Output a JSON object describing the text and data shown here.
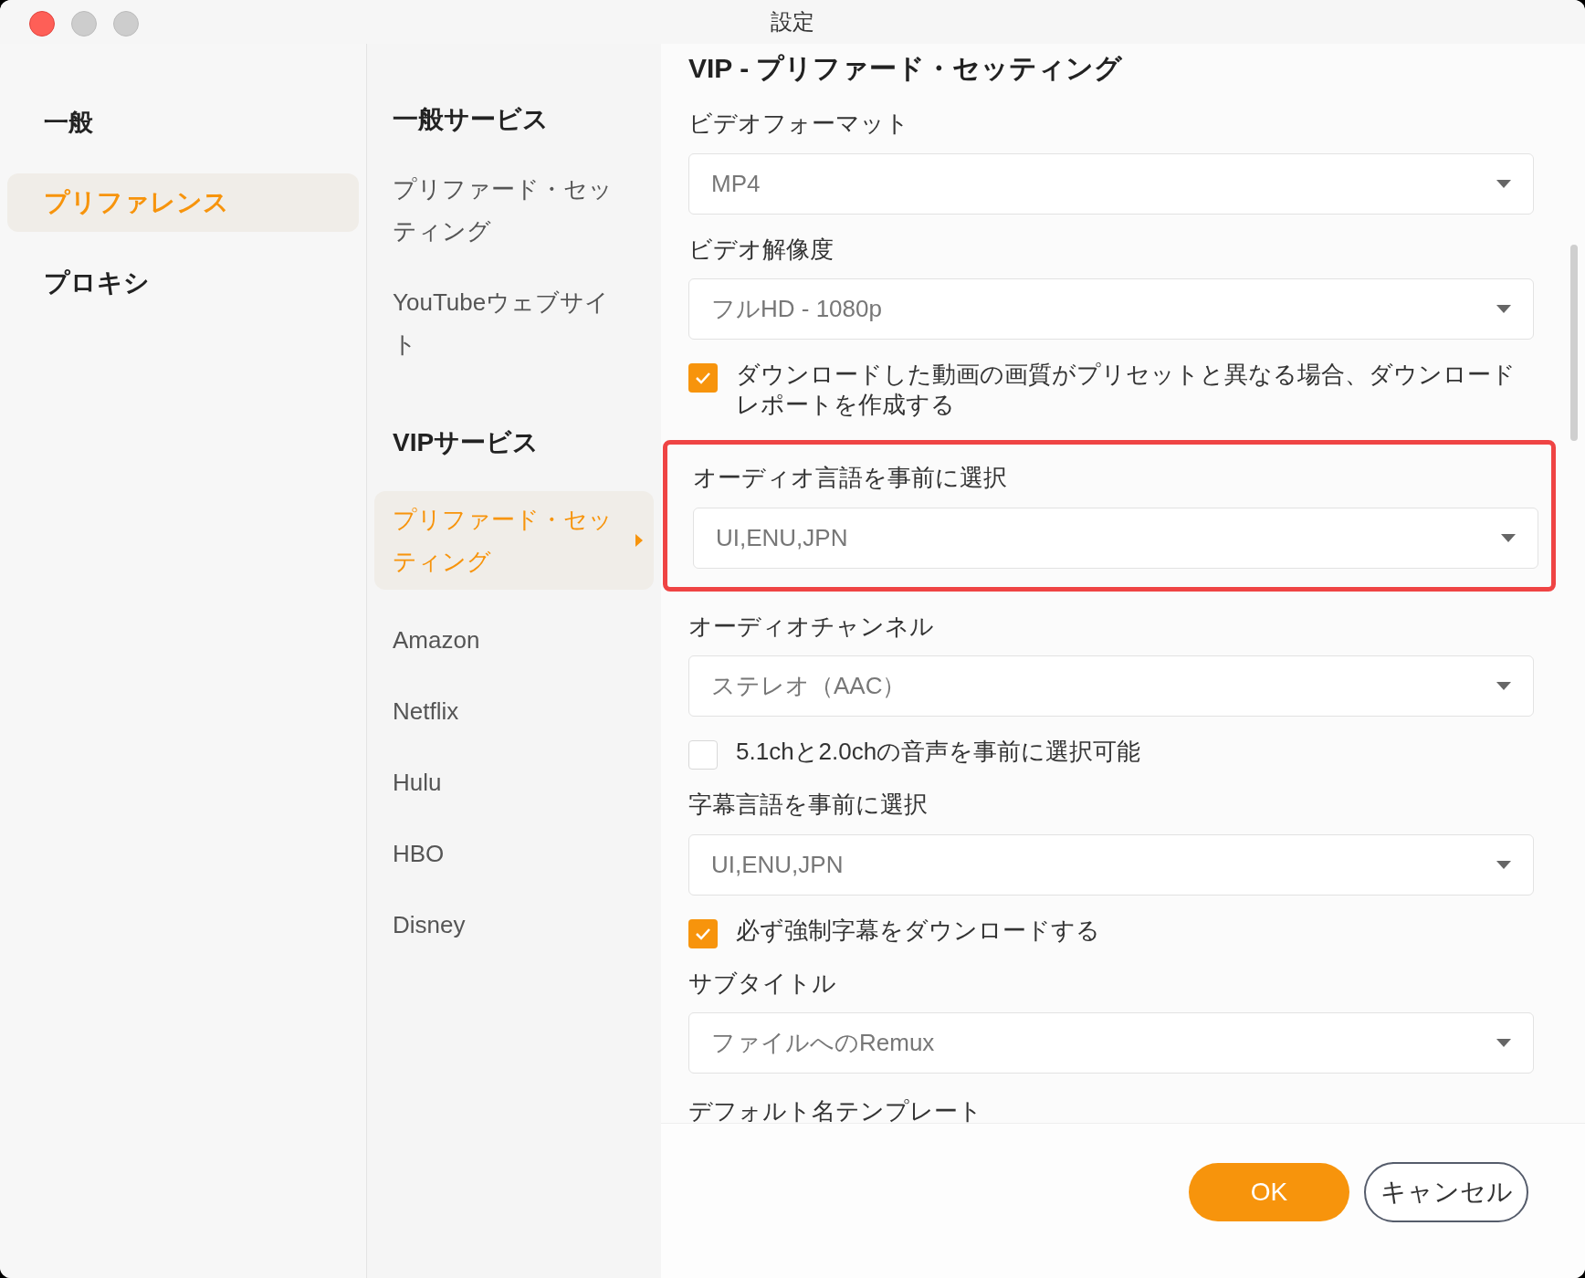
{
  "window": {
    "title": "設定"
  },
  "sidebar": {
    "items": [
      {
        "label": "一般",
        "kind": "heading",
        "selected": false
      },
      {
        "label": "プリファレンス",
        "kind": "item",
        "selected": true
      },
      {
        "label": "プロキシ",
        "kind": "item",
        "selected": false
      }
    ]
  },
  "services": [
    {
      "heading": "一般サービス",
      "items": [
        {
          "label": "プリファード・セッティング",
          "selected": false
        },
        {
          "label": "YouTubeウェブサイト",
          "selected": false
        }
      ]
    },
    {
      "heading": "VIPサービス",
      "items": [
        {
          "label": "プリファード・セッティング",
          "selected": true
        },
        {
          "label": "Amazon",
          "selected": false
        },
        {
          "label": "Netflix",
          "selected": false
        },
        {
          "label": "Hulu",
          "selected": false
        },
        {
          "label": "HBO",
          "selected": false
        },
        {
          "label": "Disney",
          "selected": false
        }
      ]
    }
  ],
  "content": {
    "title": "VIP - プリファード・セッティング",
    "settings": [
      {
        "kind": "dropdown",
        "label": "ビデオフォーマット",
        "value": "MP4",
        "highlighted": false
      },
      {
        "kind": "dropdown",
        "label": "ビデオ解像度",
        "value": "フルHD - 1080p",
        "highlighted": false
      },
      {
        "kind": "checkbox",
        "label": "ダウンロードした動画の画質がプリセットと異なる場合、ダウンロードレポートを作成する",
        "checked": true
      },
      {
        "kind": "dropdown",
        "label": "オーディオ言語を事前に選択",
        "value": "UI,ENU,JPN",
        "highlighted": true
      },
      {
        "kind": "dropdown",
        "label": "オーディオチャンネル",
        "value": "ステレオ（AAC）",
        "highlighted": false
      },
      {
        "kind": "checkbox",
        "label": "5.1chと2.0chの音声を事前に選択可能",
        "checked": false
      },
      {
        "kind": "dropdown",
        "label": "字幕言語を事前に選択",
        "value": "UI,ENU,JPN",
        "highlighted": false
      },
      {
        "kind": "checkbox",
        "label": "必ず強制字幕をダウンロードする",
        "checked": true
      },
      {
        "kind": "dropdown",
        "label": "サブタイトル",
        "value": "ファイルへのRemux",
        "highlighted": false
      },
      {
        "kind": "label",
        "label": "デフォルト名テンプレート"
      }
    ]
  },
  "buttons": [
    {
      "label": "OK",
      "kind": "primary"
    },
    {
      "label": "キャンセル",
      "kind": "secondary"
    }
  ]
}
